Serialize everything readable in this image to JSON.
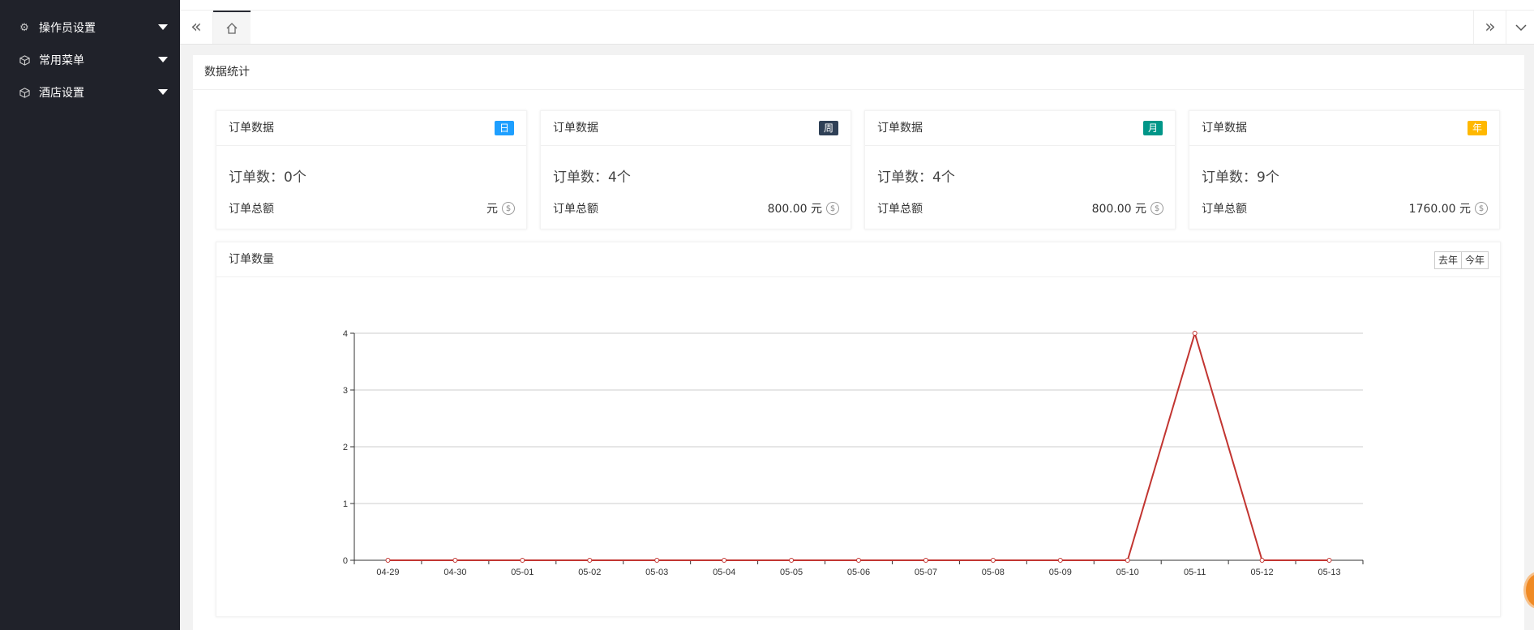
{
  "sidebar": {
    "items": [
      {
        "label": "操作员设置",
        "icon": "gear-icon"
      },
      {
        "label": "常用菜单",
        "icon": "cube-icon"
      },
      {
        "label": "酒店设置",
        "icon": "cube-icon"
      }
    ]
  },
  "topbar": {
    "nav_left": "«",
    "nav_right": "»",
    "home_icon": "home-icon"
  },
  "main": {
    "title": "数据统计",
    "cards": [
      {
        "title": "订单数据",
        "badge": "日",
        "badge_color": "#1e9fff",
        "count": "订单数：0个",
        "amount_label": "订单总额",
        "amount": "元"
      },
      {
        "title": "订单数据",
        "badge": "周",
        "badge_color": "#2f4056",
        "count": "订单数：4个",
        "amount_label": "订单总额",
        "amount": "800.00 元"
      },
      {
        "title": "订单数据",
        "badge": "月",
        "badge_color": "#009688",
        "count": "订单数：4个",
        "amount_label": "订单总额",
        "amount": "800.00 元"
      },
      {
        "title": "订单数据",
        "badge": "年",
        "badge_color": "#ffb800",
        "count": "订单数：9个",
        "amount_label": "订单总额",
        "amount": "1760.00 元"
      }
    ],
    "chart_card": {
      "title": "订单数量",
      "buttons": [
        "去年",
        "今年"
      ]
    }
  },
  "chart_data": {
    "type": "line",
    "categories": [
      "04-29",
      "04-30",
      "05-01",
      "05-02",
      "05-03",
      "05-04",
      "05-05",
      "05-06",
      "05-07",
      "05-08",
      "05-09",
      "05-10",
      "05-11",
      "05-12",
      "05-13"
    ],
    "series": [
      {
        "values": [
          0,
          0,
          0,
          0,
          0,
          0,
          0,
          0,
          0,
          0,
          0,
          0,
          4,
          0,
          0
        ],
        "color": "#c23531"
      }
    ],
    "ylim": [
      0,
      4
    ],
    "yticks": [
      0,
      1,
      2,
      3,
      4
    ],
    "grid": true,
    "title": "",
    "xlabel": "",
    "ylabel": ""
  }
}
